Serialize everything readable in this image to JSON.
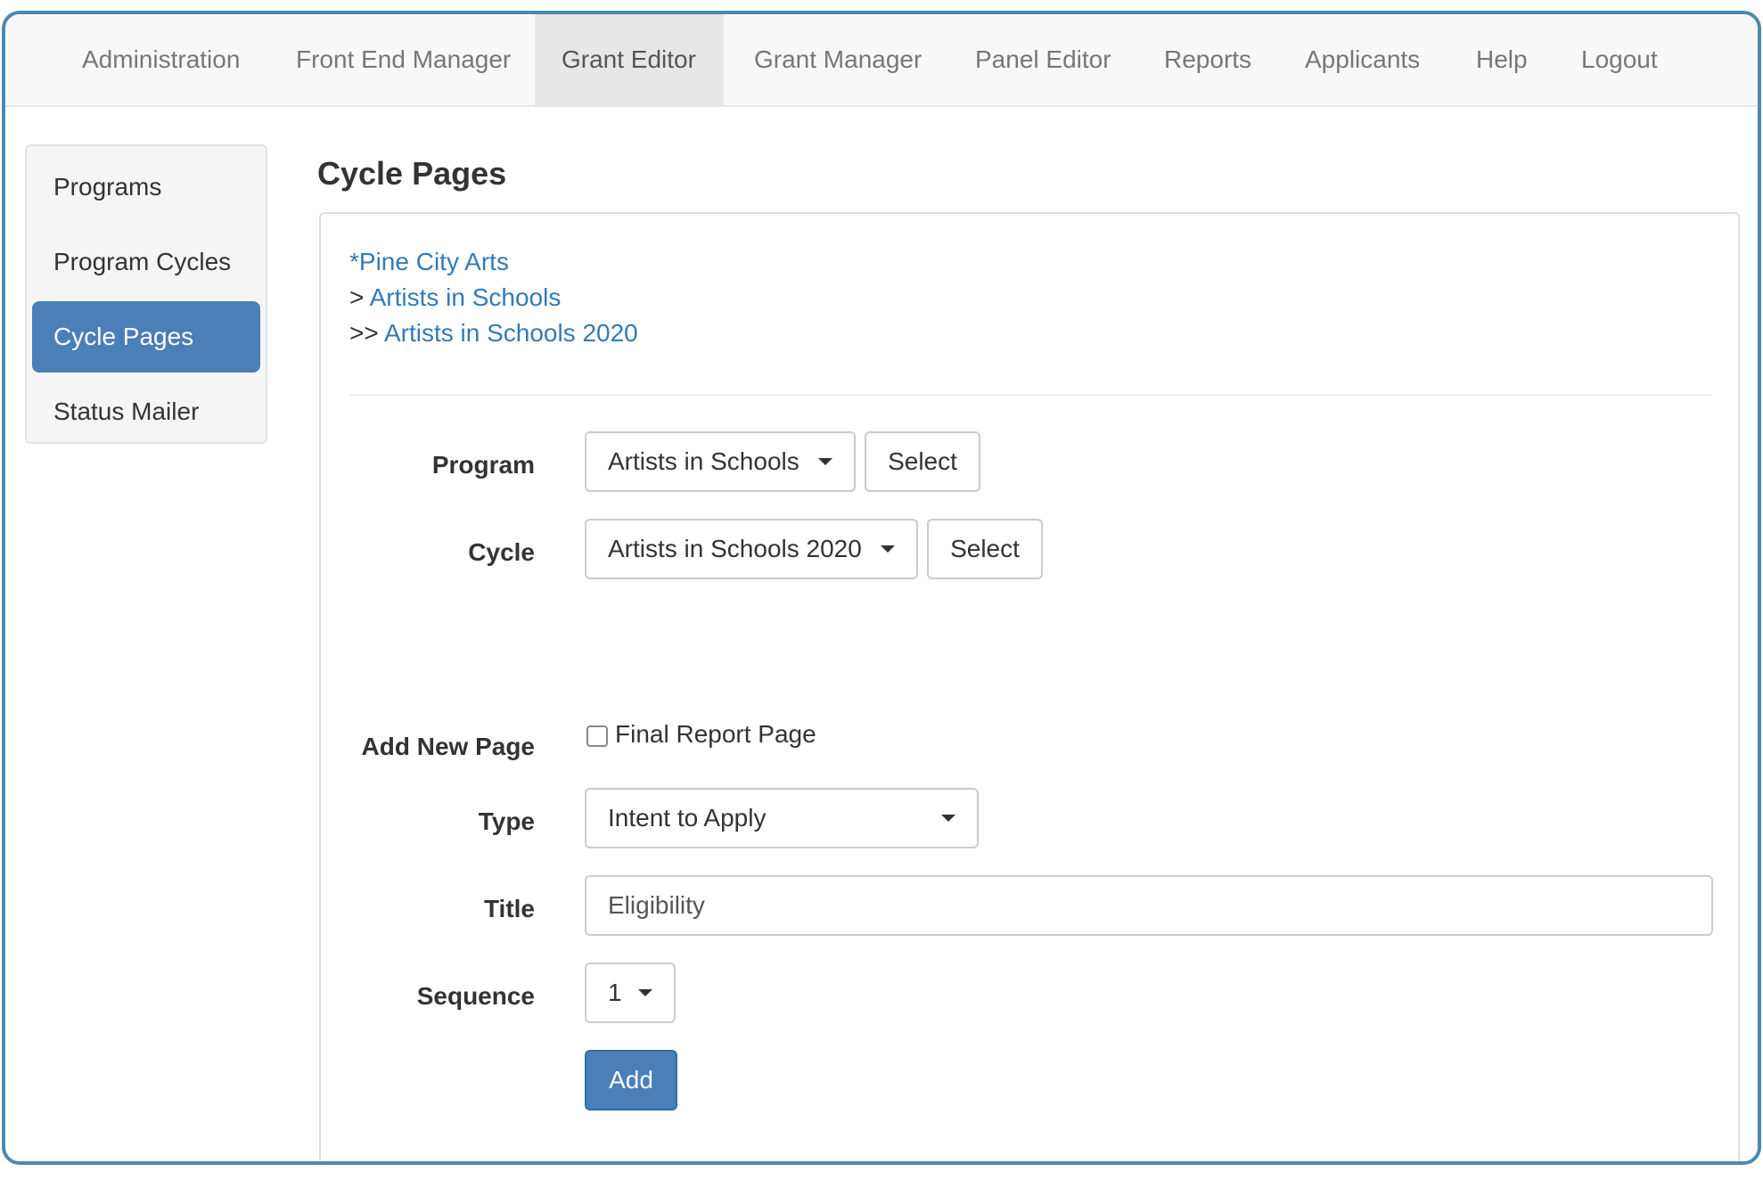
{
  "navbar": {
    "items": [
      {
        "label": "Administration"
      },
      {
        "label": "Front End Manager"
      },
      {
        "label": "Grant Editor",
        "active": true
      },
      {
        "label": "Grant Manager"
      },
      {
        "label": "Panel Editor"
      },
      {
        "label": "Reports"
      },
      {
        "label": "Applicants"
      },
      {
        "label": "Help"
      },
      {
        "label": "Logout"
      }
    ]
  },
  "sidebar": {
    "items": [
      {
        "label": "Programs"
      },
      {
        "label": "Program Cycles"
      },
      {
        "label": "Cycle Pages",
        "active": true
      },
      {
        "label": "Status Mailer"
      }
    ]
  },
  "page": {
    "title": "Cycle Pages"
  },
  "breadcrumb": {
    "org": "*Pine City Arts",
    "program_prefix": ">",
    "program": "Artists in Schools",
    "cycle_prefix": ">>",
    "cycle": "Artists in Schools 2020"
  },
  "form": {
    "program_label": "Program",
    "program_value": "Artists in Schools",
    "program_select_label": "Select",
    "cycle_label": "Cycle",
    "cycle_value": "Artists in Schools 2020",
    "cycle_select_label": "Select",
    "add_new_page_label": "Add New Page",
    "final_report_label": "Final Report Page",
    "final_report_checked": false,
    "type_label": "Type",
    "type_value": "Intent to Apply",
    "title_label": "Title",
    "title_value": "Eligibility",
    "sequence_label": "Sequence",
    "sequence_value": "1",
    "add_button_label": "Add"
  },
  "colors": {
    "primary": "#4a7fb8",
    "link": "#337ab7",
    "frame_border": "#4a8ab0"
  }
}
